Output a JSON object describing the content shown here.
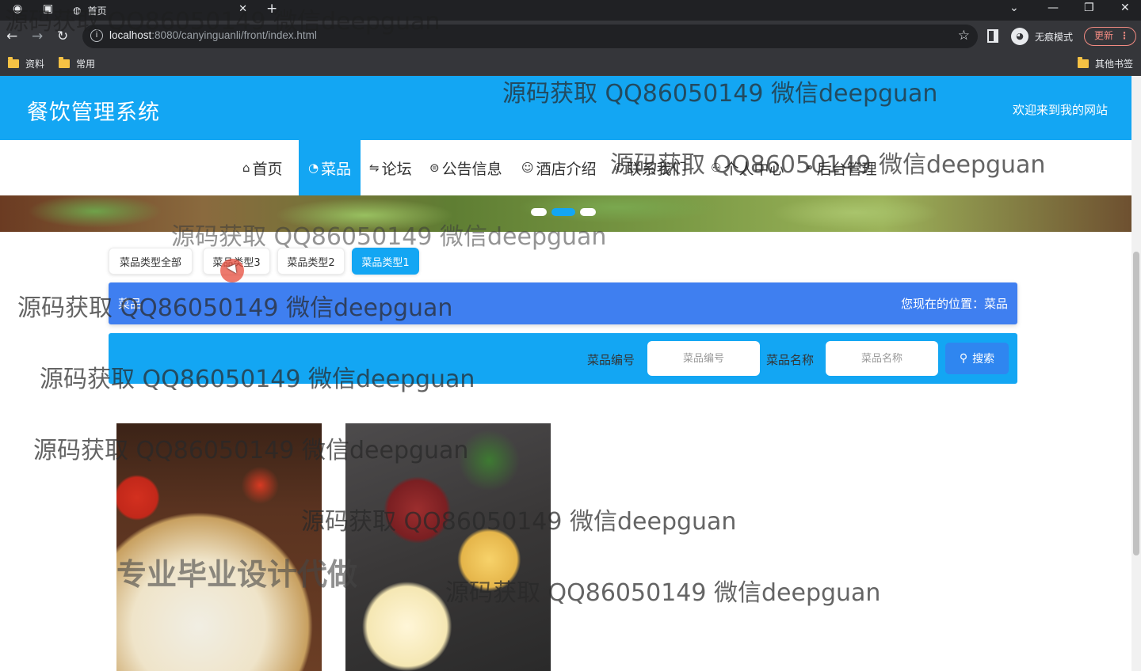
{
  "browser": {
    "tab_title": "首页",
    "url_host": "localhost",
    "url_path": ":8080/canyinguanli/front/index.html",
    "incognito_label": "无痕模式",
    "update_label": "更新",
    "bookmarks": [
      "资料",
      "常用"
    ],
    "other_bookmarks": "其他书签"
  },
  "site": {
    "title": "餐饮管理系统",
    "welcome": "欢迎来到我的网站",
    "nav": [
      {
        "icon": "⌂",
        "label": "首页"
      },
      {
        "icon": "◔",
        "label": "菜品"
      },
      {
        "icon": "⇋",
        "label": "论坛"
      },
      {
        "icon": "⊜",
        "label": "公告信息"
      },
      {
        "icon": "☺",
        "label": "酒店介绍"
      },
      {
        "icon": "✆",
        "label": "联系我们"
      },
      {
        "icon": "⚇",
        "label": "个人中心"
      },
      {
        "icon": "⚭",
        "label": "后台管理"
      }
    ],
    "active_nav": "菜品"
  },
  "filters": [
    "菜品类型全部",
    "菜品类型3",
    "菜品类型2",
    "菜品类型1"
  ],
  "active_filter": "菜品类型1",
  "position": {
    "left": "菜品",
    "right": "您现在的位置：菜品"
  },
  "search": {
    "code_label": "菜品编号",
    "code_placeholder": "菜品编号",
    "name_label": "菜品名称",
    "name_placeholder": "菜品名称",
    "button": "搜索"
  },
  "watermarks": {
    "text": "源码获取 QQ86050149 微信deepguan",
    "pro": "专业毕业设计代做"
  },
  "colors": {
    "header": "#13a6f3",
    "position_bar": "#3f7ff0",
    "search_button": "#2f86f0"
  }
}
